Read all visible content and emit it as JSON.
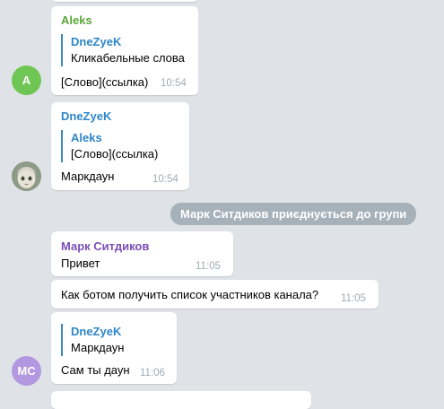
{
  "colors": {
    "background": "#dfe3e7",
    "bubble": "#ffffff",
    "aleks": "#5aa73a",
    "dnezyek": "#2f86c8",
    "mark": "#7b4fb7",
    "avatar_a": "#6fc654",
    "avatar_mc": "#b298e0",
    "service_pill": "#a7b1ba",
    "time": "#a0acb6"
  },
  "messages": {
    "m1": {
      "sender": "Aleks",
      "reply_name": "DneZyeK",
      "reply_text": "Кликабельные слова",
      "text": "[Слово](ссылка)",
      "time": "10:54"
    },
    "m2": {
      "sender": "DneZyeK",
      "reply_name": "Aleks",
      "reply_text": "[Слово](ссылка)",
      "text": "Маркдаун",
      "time": "10:54"
    },
    "service": "Марк Ситдиков приєднується до групи",
    "m3": {
      "sender": "Марк Ситдиков",
      "text": "Привет",
      "time": "11:05"
    },
    "m4": {
      "text": "Как ботом получить список участников канала?",
      "time": "11:05"
    },
    "m5": {
      "reply_name": "DneZyeK",
      "reply_text": "Маркдаун",
      "text": "Сам ты даун",
      "time": "11:06"
    }
  },
  "avatars": {
    "aleks": "A",
    "mark": "MC",
    "dnezyek_icon": "anime-face-avatar-icon"
  }
}
